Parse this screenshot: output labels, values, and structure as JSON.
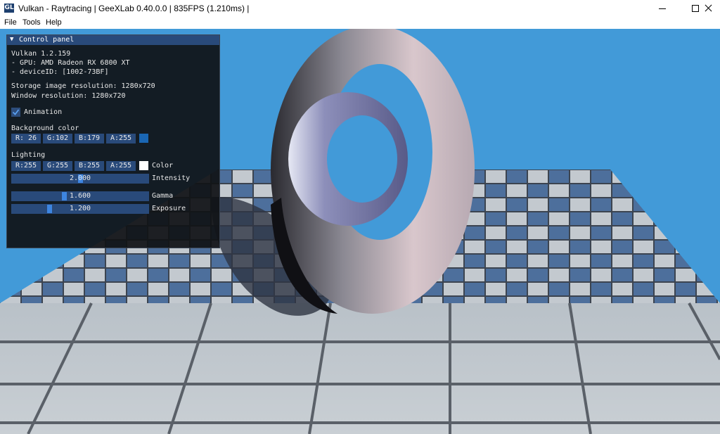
{
  "window": {
    "title": "Vulkan - Raytracing | GeeXLab 0.40.0.0 | 835FPS (1.210ms) |",
    "icon_text": "GL"
  },
  "menu": [
    "File",
    "Tools",
    "Help"
  ],
  "panel": {
    "header": "Control panel",
    "info": {
      "vulkan": "Vulkan 1.2.159",
      "gpu": "- GPU: AMD Radeon RX 6800 XT",
      "device": "- deviceID: [1002-73BF]",
      "storage": "Storage image resolution: 1280x720",
      "window": "Window resolution: 1280x720"
    },
    "animation": {
      "label": "Animation",
      "checked": true
    },
    "background": {
      "label": "Background color",
      "fields": [
        "R: 26",
        "G:102",
        "B:179",
        "A:255"
      ],
      "swatch": "#1a66b3"
    },
    "lighting": {
      "label": "Lighting",
      "fields": [
        "R:255",
        "G:255",
        "B:255",
        "A:255"
      ],
      "color_label": "Color",
      "swatch": "#ffffff"
    },
    "sliders": [
      {
        "value_text": "2.000",
        "label": "Intensity",
        "fraction": 0.5
      },
      {
        "value_text": "1.600",
        "label": "Gamma",
        "fraction": 0.38
      },
      {
        "value_text": "1.200",
        "label": "Exposure",
        "fraction": 0.27
      }
    ]
  },
  "colors": {
    "background": "#429ad8",
    "panel_accent": "#294a7a",
    "grab": "#3d85e0"
  }
}
